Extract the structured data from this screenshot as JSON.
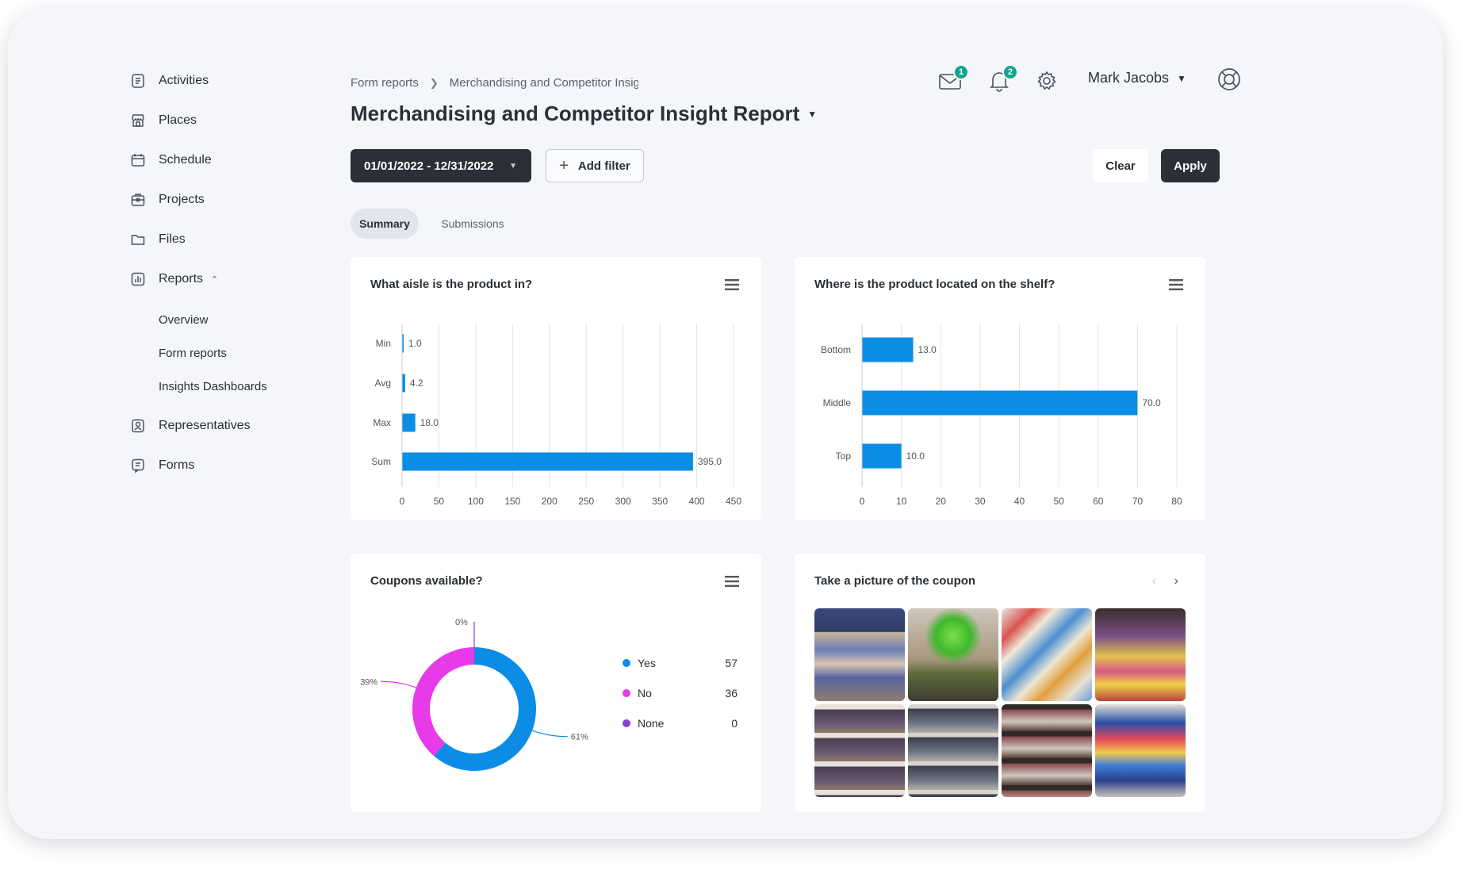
{
  "sidebar": {
    "items": [
      {
        "label": "Activities",
        "icon": "activities-icon"
      },
      {
        "label": "Places",
        "icon": "store-icon"
      },
      {
        "label": "Schedule",
        "icon": "calendar-icon"
      },
      {
        "label": "Projects",
        "icon": "briefcase-icon"
      },
      {
        "label": "Files",
        "icon": "folder-icon"
      },
      {
        "label": "Reports",
        "icon": "report-chart-icon"
      },
      {
        "label": "Representatives",
        "icon": "person-badge-icon"
      },
      {
        "label": "Forms",
        "icon": "form-icon"
      }
    ],
    "reports_sub": [
      "Overview",
      "Form reports",
      "Insights Dashboards"
    ]
  },
  "header": {
    "breadcrumb": [
      "Form reports",
      "Merchandising and Competitor Insight"
    ],
    "title": "Merchandising and Competitor Insight Report",
    "mail_count": "1",
    "notification_count": "2",
    "user_name": "Mark Jacobs"
  },
  "filters": {
    "date_range": "01/01/2022 - 12/31/2022",
    "add_filter_label": "Add filter",
    "clear_label": "Clear",
    "apply_label": "Apply"
  },
  "tabs": [
    "Summary",
    "Submissions"
  ],
  "active_tab": "Summary",
  "colors": {
    "accent": "#0b8de6",
    "dark": "#2b2f36",
    "no": "#e83ae8",
    "none": "#8a3fd6",
    "badge": "#14a48f"
  },
  "cards": {
    "aisle": {
      "title": "What aisle is the product in?"
    },
    "shelf": {
      "title": "Where is the product located on the shelf?"
    },
    "coupons": {
      "title": "Coupons available?"
    },
    "photos": {
      "title": "Take a picture of the coupon"
    }
  },
  "chart_data": [
    {
      "type": "bar",
      "orientation": "horizontal",
      "title": "What aisle is the product in?",
      "categories": [
        "Min",
        "Avg",
        "Max",
        "Sum"
      ],
      "values": [
        1.0,
        4.2,
        18.0,
        395.0
      ],
      "value_labels": [
        "1.0",
        "4.2",
        "18.0",
        "395.0"
      ],
      "xlim": [
        0,
        450
      ],
      "xticks": [
        0,
        50,
        100,
        150,
        200,
        250,
        300,
        350,
        400,
        450
      ],
      "grid": true
    },
    {
      "type": "bar",
      "orientation": "horizontal",
      "title": "Where is the product located on the shelf?",
      "categories": [
        "Bottom",
        "Middle",
        "Top"
      ],
      "values": [
        13.0,
        70.0,
        10.0
      ],
      "value_labels": [
        "13.0",
        "70.0",
        "10.0"
      ],
      "xlim": [
        0,
        80
      ],
      "xticks": [
        0,
        10,
        20,
        30,
        40,
        50,
        60,
        70,
        80
      ],
      "grid": true
    },
    {
      "type": "pie",
      "donut": true,
      "title": "Coupons available?",
      "categories": [
        "Yes",
        "No",
        "None"
      ],
      "values": [
        57,
        36,
        0
      ],
      "value_labels": [
        "57",
        "36",
        "0"
      ],
      "percent_labels": [
        "61%",
        "39%",
        "0%"
      ],
      "legend": "right"
    }
  ]
}
